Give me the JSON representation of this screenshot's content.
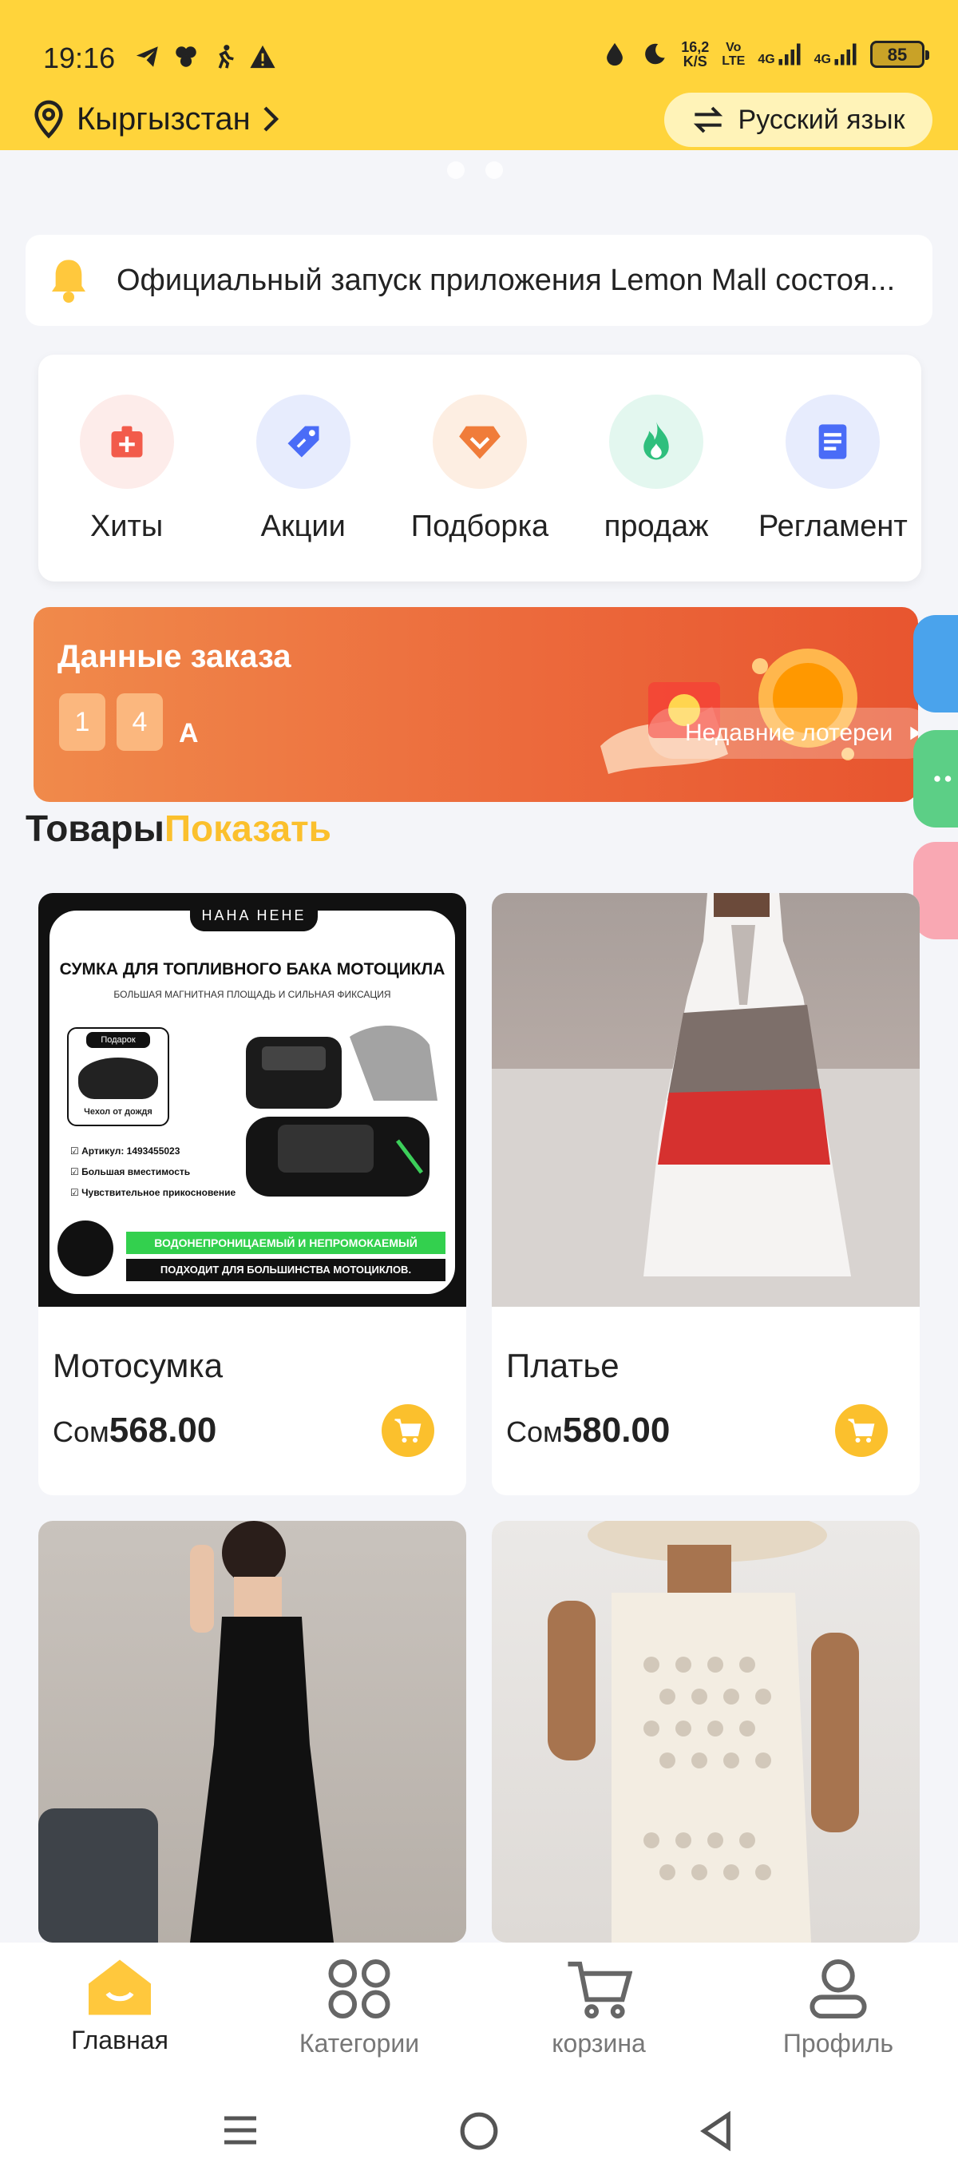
{
  "status_bar": {
    "time": "19:16",
    "speed_value": "16,2",
    "speed_unit": "K/S",
    "net1_top": "Vo",
    "net1_bottom": "LTE",
    "net2": "4G",
    "net3": "4G",
    "battery": "85"
  },
  "header": {
    "region": "Кыргызстан",
    "language": "Русский язык"
  },
  "notice": {
    "text": "Официальный запуск приложения Lemon Mall состоя..."
  },
  "quick_menu": [
    {
      "label": "Хиты",
      "icon": "first-aid-icon",
      "bg": "#fdecea",
      "color": "#f25b4b"
    },
    {
      "label": "Акции",
      "icon": "tag-icon",
      "bg": "#e7ecfd",
      "color": "#4a6cf7"
    },
    {
      "label": "Подборка",
      "icon": "diamond-icon",
      "bg": "#fdeee2",
      "color": "#f07c3a"
    },
    {
      "label": "продаж",
      "icon": "flame-icon",
      "bg": "#e3f7ef",
      "color": "#2fbf7d"
    },
    {
      "label": "Регламент",
      "icon": "document-icon",
      "bg": "#e7ecfd",
      "color": "#4a6cf7"
    }
  ],
  "order_banner": {
    "title": "Данные заказа",
    "digits": [
      "1",
      "4"
    ],
    "unit": "A",
    "lottery_label": "Недавние лотереи"
  },
  "products_section": {
    "title_part1": "Товары",
    "title_part2": "Показать"
  },
  "products": [
    {
      "name": "Мотосумка",
      "currency": "Сом",
      "price": "568.00"
    },
    {
      "name": "Платье",
      "currency": "Сом",
      "price": "580.00"
    },
    {
      "name": "",
      "currency": "",
      "price": ""
    },
    {
      "name": "",
      "currency": "",
      "price": ""
    }
  ],
  "product_image_text": {
    "brand": "HAHA HEHE",
    "headline": "СУМКА ДЛЯ ТОПЛИВНОГО БАКА МОТОЦИКЛА",
    "sub": "БОЛЬШАЯ МАГНИТНАЯ ПЛОЩАДЬ И СИЛЬНАЯ ФИКСАЦИЯ",
    "gift": "Подарок",
    "cover": "Чехол от дождя",
    "f1": "Артикул: 1493455023",
    "f2": "Большая вместимость",
    "f3": "Чувствительное прикосновение",
    "green": "ВОДОНЕПРОНИЦАЕМЫЙ И НЕПРОМОКАЕМЫЙ",
    "bottom": "ПОДХОДИТ ДЛЯ БОЛЬШИНСТВА МОТОЦИКЛОВ."
  },
  "bottom_nav": [
    {
      "label": "Главная",
      "icon": "home-icon",
      "active": true
    },
    {
      "label": "Категории",
      "icon": "categories-icon",
      "active": false
    },
    {
      "label": "корзина",
      "icon": "cart-icon",
      "active": false
    },
    {
      "label": "Профиль",
      "icon": "profile-icon",
      "active": false
    }
  ],
  "colors": {
    "brand_yellow": "#ffd43b",
    "accent_yellow": "#fbc02d",
    "order_orange": "#ec6a3c"
  }
}
